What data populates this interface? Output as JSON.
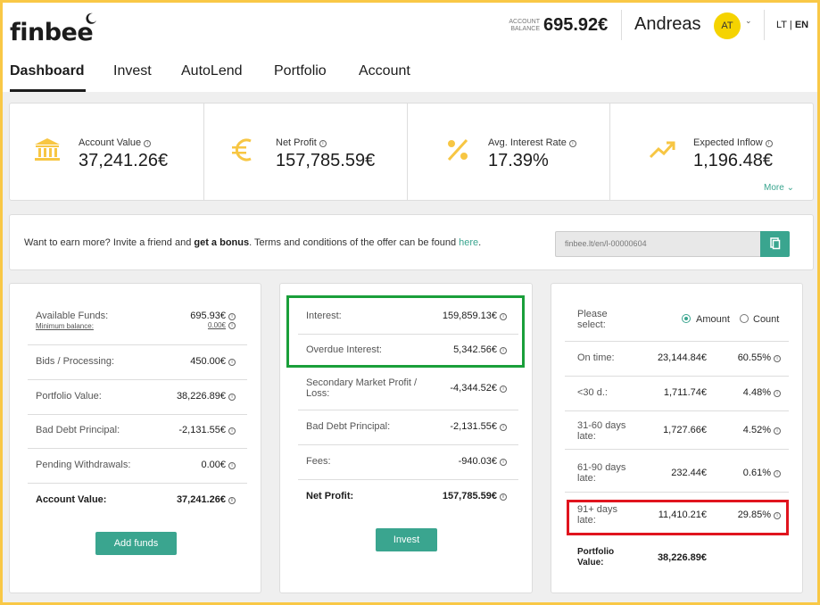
{
  "header": {
    "logo": "finbee",
    "balance_label_1": "ACCOUNT",
    "balance_label_2": "BALANCE",
    "balance_value": "695.92€",
    "user_name": "Andreas",
    "avatar_initials": "AT",
    "lang_lt": "LT",
    "lang_sep": " | ",
    "lang_en": "EN"
  },
  "nav": [
    "Dashboard",
    "Invest",
    "AutoLend",
    "Portfolio",
    "Account"
  ],
  "stats": [
    {
      "label": "Account Value",
      "value": "37,241.26€",
      "icon": "bank-icon"
    },
    {
      "label": "Net Profit",
      "value": "157,785.59€",
      "icon": "euro-icon"
    },
    {
      "label": "Avg. Interest Rate",
      "value": "17.39%",
      "icon": "percent-icon"
    },
    {
      "label": "Expected Inflow",
      "value": "1,196.48€",
      "icon": "trend-up-icon"
    }
  ],
  "more_label": "More",
  "referral": {
    "text_1": "Want to earn more? Invite a friend and ",
    "text_bold": "get a bonus",
    "text_2": ". Terms and conditions of the offer can be found ",
    "link": "here",
    "text_3": ".",
    "url": "finbee.lt/en/l-00000604"
  },
  "funds_panel": {
    "rows": [
      {
        "label": "Available Funds:",
        "value": "695.93€",
        "sub_label": "Minimum balance:",
        "sub_value": "0.00€"
      },
      {
        "label": "Bids / Processing:",
        "value": "450.00€"
      },
      {
        "label": "Portfolio Value:",
        "value": "38,226.89€"
      },
      {
        "label": "Bad Debt Principal:",
        "value": "-2,131.55€"
      },
      {
        "label": "Pending Withdrawals:",
        "value": "0.00€"
      },
      {
        "label": "Account Value:",
        "value": "37,241.26€"
      }
    ],
    "button": "Add funds"
  },
  "profit_panel": {
    "rows": [
      {
        "label": "Interest:",
        "value": "159,859.13€"
      },
      {
        "label": "Overdue Interest:",
        "value": "5,342.56€"
      },
      {
        "label": "Secondary Market Profit / Loss:",
        "value": "-4,344.52€"
      },
      {
        "label": "Bad Debt Principal:",
        "value": "-2,131.55€"
      },
      {
        "label": "Fees:",
        "value": "-940.03€"
      },
      {
        "label": "Net Profit:",
        "value": "157,785.59€"
      }
    ],
    "button": "Invest"
  },
  "portfolio_panel": {
    "please_select": "Please select:",
    "radio_amount": "Amount",
    "radio_count": "Count",
    "rows": [
      {
        "label": "On time:",
        "amount": "23,144.84€",
        "pct": "60.55%"
      },
      {
        "label": "<30 d.:",
        "amount": "1,711.74€",
        "pct": "4.48%"
      },
      {
        "label": "31-60 days late:",
        "amount": "1,727.66€",
        "pct": "4.52%"
      },
      {
        "label": "61-90 days late:",
        "amount": "232.44€",
        "pct": "0.61%"
      },
      {
        "label": "91+ days late:",
        "amount": "11,410.21€",
        "pct": "29.85%"
      }
    ],
    "total_label": "Portfolio Value:",
    "total_value": "38,226.89€"
  },
  "colors": {
    "accent": "#3aa58f",
    "icon_yellow": "#f7c643",
    "highlight_green": "#1a9f3a",
    "highlight_red": "#e0141e"
  }
}
